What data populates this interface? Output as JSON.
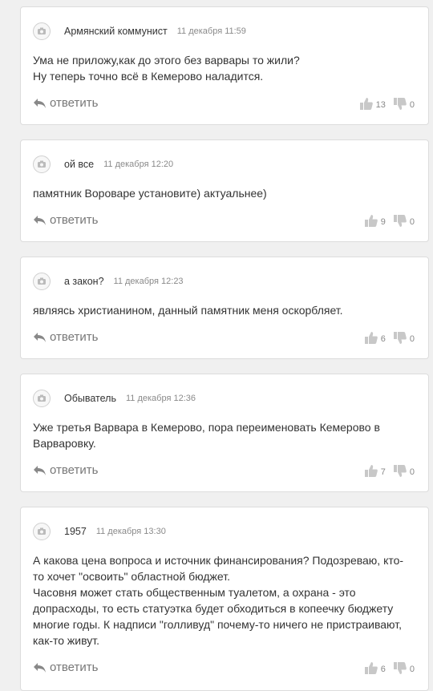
{
  "comments": [
    {
      "author": "Армянский коммунист",
      "time": "11 декабря 11:59",
      "lines": [
        "Ума не приложу,как до этого без варвары то жили?",
        "Ну теперь точно всё в Кемерово наладится."
      ],
      "reply_label": "ответить",
      "likes": "13",
      "dislikes": "0"
    },
    {
      "author": "ой все",
      "time": "11 декабря 12:20",
      "lines": [
        "памятник Вороваре установите) актуальнее)"
      ],
      "reply_label": "ответить",
      "likes": "9",
      "dislikes": "0"
    },
    {
      "author": "а закон?",
      "time": "11 декабря 12:23",
      "lines": [
        "являясь христианином, данный памятник меня оскорбляет."
      ],
      "reply_label": "ответить",
      "likes": "6",
      "dislikes": "0"
    },
    {
      "author": "Обыватель",
      "time": "11 декабря 12:36",
      "lines": [
        "Уже третья Варвара в Кемерово, пора переименовать Кемерово в Варваровку."
      ],
      "reply_label": "ответить",
      "likes": "7",
      "dislikes": "0"
    },
    {
      "author": "1957",
      "time": "11 декабря 13:30",
      "lines": [
        "А какова цена вопроса и источник финансирования? Подозреваю, кто-то хочет \"освоить\" областной бюджет.",
        "Часовня может стать общественным туалетом, а охрана - это допрасходы, то есть статуэтка будет обходиться в копеечку бюджету многие годы. К надписи \"голливуд\" почему-то ничего не пристраивают, как-то живут."
      ],
      "reply_label": "ответить",
      "likes": "6",
      "dislikes": "0"
    }
  ]
}
